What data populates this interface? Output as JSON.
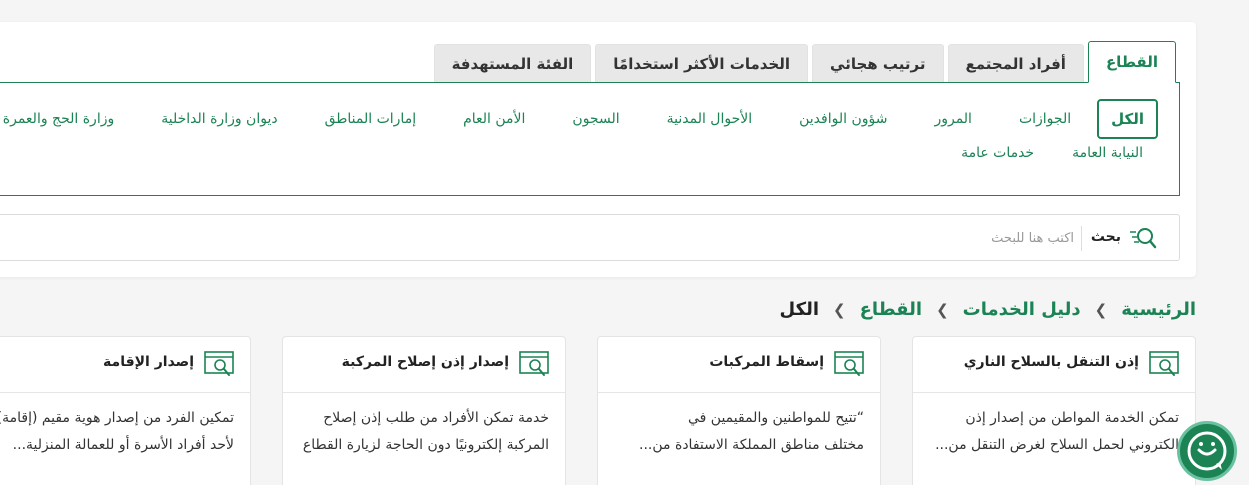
{
  "tabs": [
    {
      "label": "القطاع",
      "active": true
    },
    {
      "label": "أفراد المجتمع",
      "active": false
    },
    {
      "label": "ترتيب هجائي",
      "active": false
    },
    {
      "label": "الخدمات الأكثر استخدامًا",
      "active": false
    },
    {
      "label": "الفئة المستهدفة",
      "active": false
    }
  ],
  "categories": {
    "row1": [
      "الكل",
      "الجوازات",
      "المرور",
      "شؤون الوافدين",
      "الأحوال المدنية",
      "السجون",
      "الأمن العام",
      "إمارات المناطق",
      "ديوان وزارة الداخلية",
      "وزارة الحج والعمرة"
    ],
    "row2": [
      "النيابة العامة",
      "خدمات عامة"
    ],
    "active": "الكل"
  },
  "search": {
    "label": "بحث",
    "placeholder": "اكتب هنا للبحث"
  },
  "breadcrumb": [
    "الرئيسية",
    "دليل الخدمات",
    "القطاع",
    "الكل"
  ],
  "cards": [
    {
      "title": "إذن التنقل بالسلاح الناري",
      "desc": "تمكن الخدمة المواطن من إصدار إذن\nالكتروني لحمل السلاح لغرض التنقل من..."
    },
    {
      "title": "إسقاط المركبات",
      "desc": "“تتيح للمواطنين والمقيمين في\nمختلف مناطق المملكة الاستفادة من..."
    },
    {
      "title": "إصدار إذن إصلاح المركبة",
      "desc": "خدمة تمكن الأفراد من طلب إذن إصلاح\nالمركبة إلكترونيًا دون الحاجة لزيارة القطاع"
    },
    {
      "title": "إصدار الإقامة",
      "desc": "تمكين الفرد من إصدار هوية مقيم (إقامة)\nلأحد أفراد الأسرة أو للعمالة المنزلية..."
    }
  ],
  "colors": {
    "accent": "#1b8354",
    "fab_ring": "#6ac1a0"
  },
  "icons": {
    "search": "search-icon",
    "card": "service-icon",
    "fab": "chat-assistant-icon"
  }
}
